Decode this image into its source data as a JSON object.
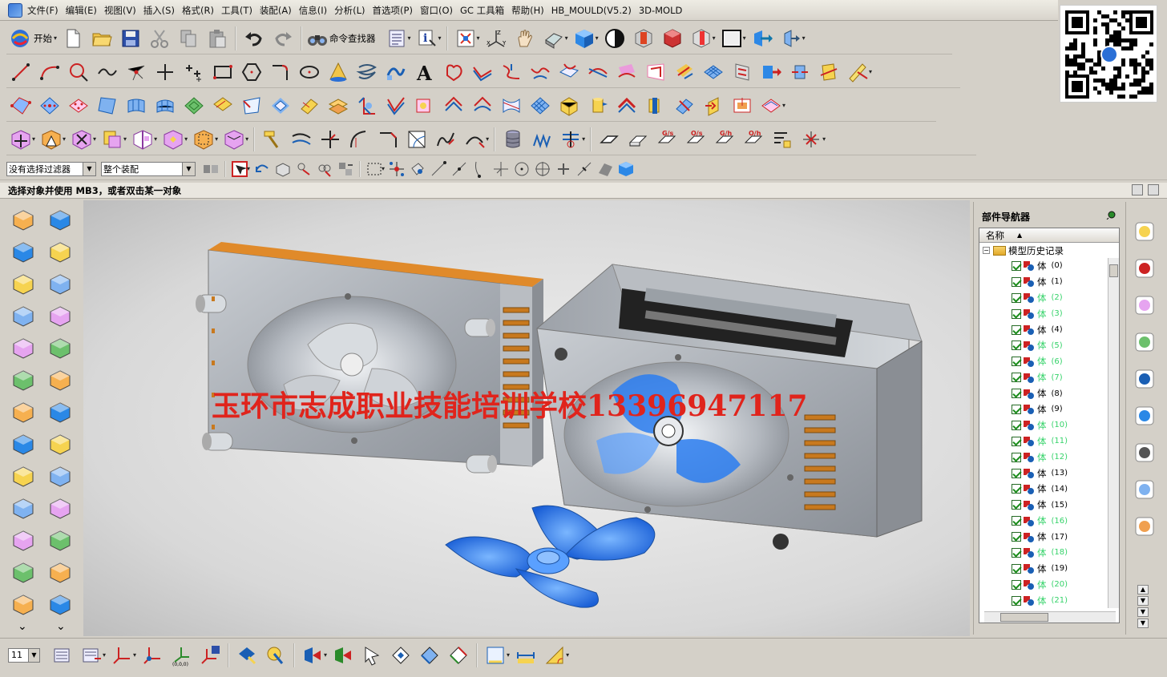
{
  "menubar": {
    "items": [
      "文件(F)",
      "编辑(E)",
      "视图(V)",
      "插入(S)",
      "格式(R)",
      "工具(T)",
      "装配(A)",
      "信息(I)",
      "分析(L)",
      "首选项(P)",
      "窗口(O)",
      "GC 工具箱",
      "帮助(H)",
      "HB_MOULD(V5.2)",
      "3D-MOLD"
    ]
  },
  "toolbar": {
    "start_label": "开始",
    "command_finder_label": "命令查找器"
  },
  "selection_bar": {
    "filter_value": "没有选择过滤器",
    "scope_value": "整个装配"
  },
  "status": {
    "prompt": "选择对象并使用 MB3，或者双击某一对象"
  },
  "viewport": {
    "watermark": "玉环市志成职业技能培训学校13396947117"
  },
  "navigator": {
    "title": "部件导航器",
    "column_name": "名称",
    "root_label": "模型历史记录",
    "items": [
      {
        "label": "体",
        "id": "(0)",
        "dim": false
      },
      {
        "label": "体",
        "id": "(1)",
        "dim": false
      },
      {
        "label": "体",
        "id": "(2)",
        "dim": true
      },
      {
        "label": "体",
        "id": "(3)",
        "dim": true
      },
      {
        "label": "体",
        "id": "(4)",
        "dim": false
      },
      {
        "label": "体",
        "id": "(5)",
        "dim": true
      },
      {
        "label": "体",
        "id": "(6)",
        "dim": true
      },
      {
        "label": "体",
        "id": "(7)",
        "dim": true
      },
      {
        "label": "体",
        "id": "(8)",
        "dim": false
      },
      {
        "label": "体",
        "id": "(9)",
        "dim": false
      },
      {
        "label": "体",
        "id": "(10)",
        "dim": true
      },
      {
        "label": "体",
        "id": "(11)",
        "dim": true
      },
      {
        "label": "体",
        "id": "(12)",
        "dim": true
      },
      {
        "label": "体",
        "id": "(13)",
        "dim": false
      },
      {
        "label": "体",
        "id": "(14)",
        "dim": false
      },
      {
        "label": "体",
        "id": "(15)",
        "dim": false
      },
      {
        "label": "体",
        "id": "(16)",
        "dim": true
      },
      {
        "label": "体",
        "id": "(17)",
        "dim": false
      },
      {
        "label": "体",
        "id": "(18)",
        "dim": true
      },
      {
        "label": "体",
        "id": "(19)",
        "dim": false
      },
      {
        "label": "体",
        "id": "(20)",
        "dim": true
      },
      {
        "label": "体",
        "id": "(21)",
        "dim": true
      }
    ]
  },
  "bottombar": {
    "layer_value": "11"
  },
  "colors": {
    "watermark": "#e0241c",
    "dim_item": "#36d36a",
    "fan_blue": "#2a7df0"
  }
}
